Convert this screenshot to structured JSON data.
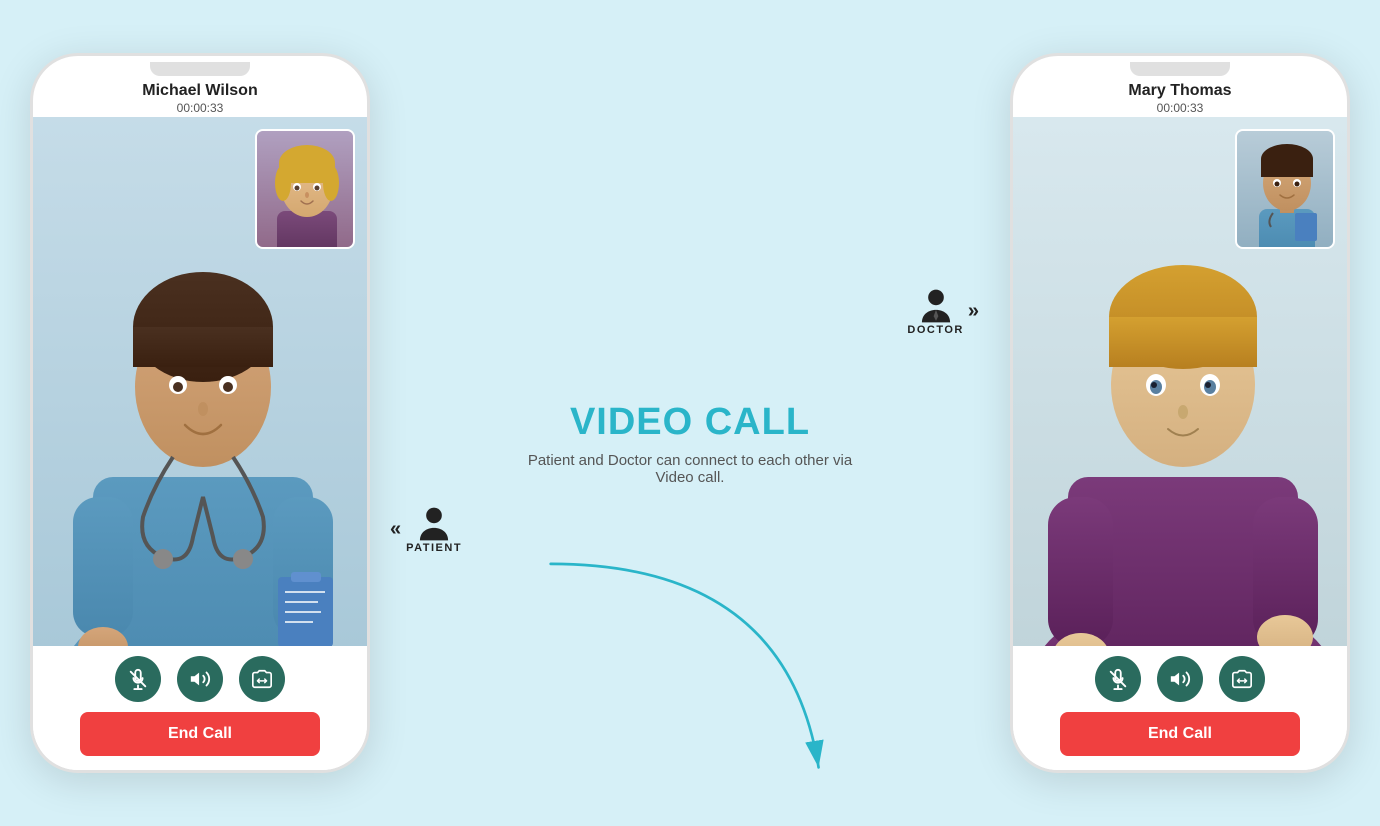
{
  "page": {
    "background_color": "#d6f0f7"
  },
  "title": {
    "text": "VIDEO CALL",
    "color": "#2ab5c9"
  },
  "description": {
    "text": "Patient and Doctor can connect to each other via Video call."
  },
  "left_phone": {
    "caller_name": "Michael Wilson",
    "call_timer": "00:00:33",
    "end_call_label": "End Call",
    "role": "PATIENT"
  },
  "right_phone": {
    "caller_name": "Mary Thomas",
    "call_timer": "00:00:33",
    "end_call_label": "End Call",
    "role": "DOCTOR"
  },
  "labels": {
    "patient": "PATIENT",
    "doctor": "DOCTOR"
  },
  "icons": {
    "mute": "microphone-slash",
    "speaker": "volume",
    "flip": "camera-flip",
    "chevron_left": "«",
    "chevron_right": "»"
  }
}
